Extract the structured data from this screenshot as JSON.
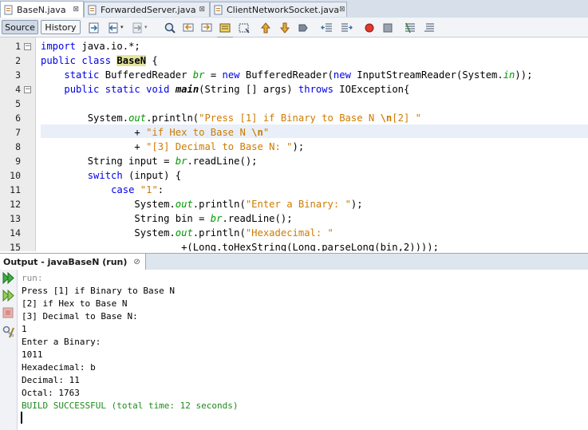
{
  "tabs": [
    {
      "label": "BaseN.java",
      "active": true
    },
    {
      "label": "ForwardedServer.java",
      "active": false
    },
    {
      "label": "ClientNetworkSocket.java",
      "active": false
    }
  ],
  "toolbar": {
    "source_label": "Source",
    "history_label": "History",
    "icons": [
      "last-edit-icon",
      "back-icon",
      "forward-icon",
      "find-selection-icon",
      "find-previous-icon",
      "find-next-icon",
      "toggle-highlight-icon",
      "toggle-rect-selection-icon",
      "previous-bookmark-icon",
      "next-bookmark-icon",
      "toggle-bookmark-icon",
      "shift-left-icon",
      "shift-right-icon",
      "start-macro-icon",
      "stop-macro-icon",
      "comment-icon",
      "uncomment-icon"
    ]
  },
  "editor": {
    "line_numbers": [
      "1",
      "2",
      "3",
      "4",
      "5",
      "6",
      "7",
      "8",
      "9",
      "10",
      "11",
      "12",
      "13",
      "14",
      "15"
    ],
    "lines": [
      "import java.io.*;",
      "public class BaseN {",
      "    static BufferedReader br = new BufferedReader(new InputStreamReader(System.in));",
      "    public static void main(String [] args) throws IOException{",
      "",
      "        System.out.println(\"Press [1] if Binary to Base N \\n[2] \"",
      "                + \"if Hex to Base N \\n\"",
      "                + \"[3] Decimal to Base N: \");",
      "        String input = br.readLine();",
      "        switch (input) {",
      "            case \"1\":",
      "                System.out.println(\"Enter a Binary: \");",
      "                String bin = br.readLine();",
      "                System.out.println(\"Hexadecimal: \"",
      "                        +(Long.toHexString(Long.parseLong(bin,2))));"
    ]
  },
  "output": {
    "title": "Output - javaBaseN (run)",
    "close_label": "⊘",
    "lines": [
      "run:",
      "Press [1] if Binary to Base N",
      "[2] if Hex to Base N",
      "[3] Decimal to Base N:",
      "1",
      "Enter a Binary:",
      "1011",
      "Hexadecimal: b",
      "Decimal: 11",
      "Octal: 1763",
      "BUILD SUCCESSFUL (total time: 12 seconds)"
    ]
  },
  "colors": {
    "keyword": "#0000e6",
    "string": "#ce7b00",
    "field": "#009900",
    "build_ok": "#1f8a1f"
  }
}
